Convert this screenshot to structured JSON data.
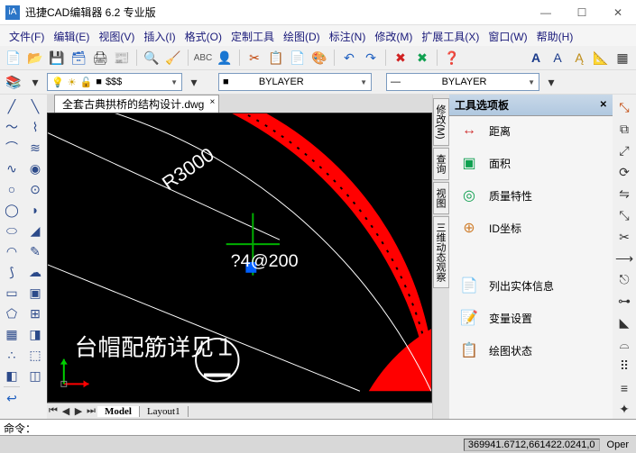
{
  "title": "迅捷CAD编辑器 6.2 专业版",
  "menus": [
    "文件(F)",
    "编辑(E)",
    "视图(V)",
    "插入(I)",
    "格式(O)",
    "定制工具",
    "绘图(D)",
    "标注(N)",
    "修改(M)",
    "扩展工具(X)",
    "窗口(W)",
    "帮助(H)"
  ],
  "layer_combo1": "$$$",
  "layer_combo2": "BYLAYER",
  "layer_combo3": "BYLAYER",
  "doc_tab": "全套古典拱桥的结构设计.dwg",
  "model_tabs": [
    "Model",
    "Layout1"
  ],
  "palette_title": "工具选项板",
  "vert_tabs": [
    "修改(M)",
    "查询",
    "视图",
    "三维动态观察"
  ],
  "palette_items": [
    {
      "icon": "↔",
      "color": "#d03030",
      "label": "距离"
    },
    {
      "icon": "▣",
      "color": "#10a050",
      "label": "面积"
    },
    {
      "icon": "◎",
      "color": "#10a050",
      "label": "质量特性"
    },
    {
      "icon": "⊕",
      "color": "#d08030",
      "label": "ID坐标"
    },
    {
      "icon": "📄",
      "color": "#2060c0",
      "label": "列出实体信息"
    },
    {
      "icon": "📝",
      "color": "#2060c0",
      "label": "变量设置"
    },
    {
      "icon": "📋",
      "color": "#2060c0",
      "label": "绘图状态"
    }
  ],
  "canvas_text": {
    "r3000": "R3000",
    "dim": "?4@200",
    "banner": "台帽配筋详见１"
  },
  "cmd_prompt": "命令：",
  "status_coords": "369941.6712,661422.0241,0",
  "status_mode": "Oper"
}
